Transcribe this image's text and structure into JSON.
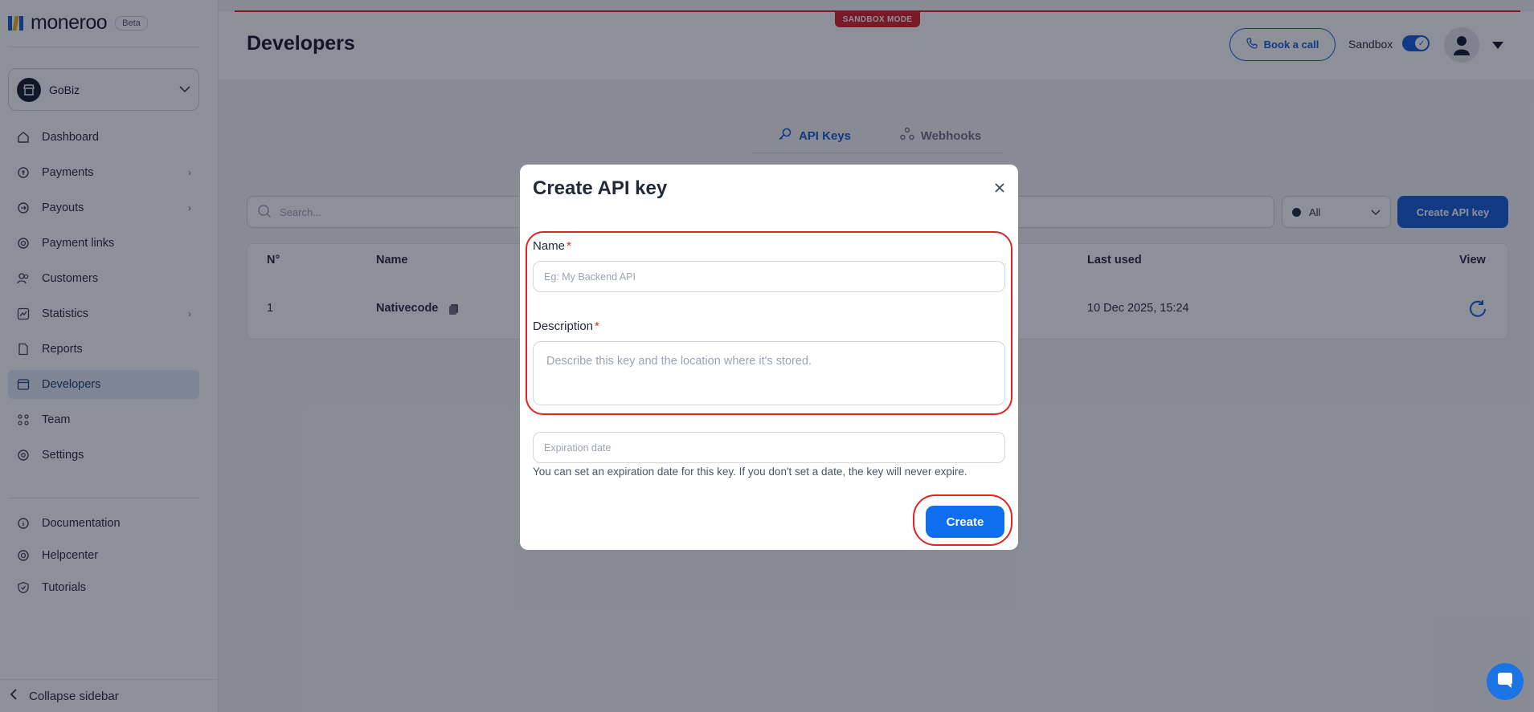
{
  "brand": {
    "name": "moneroo",
    "badge": "Beta"
  },
  "org": {
    "name": "GoBiz"
  },
  "nav": [
    {
      "label": "Dashboard"
    },
    {
      "label": "Payments",
      "arrow": "›"
    },
    {
      "label": "Payouts",
      "arrow": "›"
    },
    {
      "label": "Payment links"
    },
    {
      "label": "Customers"
    },
    {
      "label": "Statistics",
      "arrow": "›"
    },
    {
      "label": "Reports"
    },
    {
      "label": "Developers"
    },
    {
      "label": "Team"
    },
    {
      "label": "Settings"
    }
  ],
  "nav_secondary": [
    {
      "label": "Documentation"
    },
    {
      "label": "Helpcenter"
    },
    {
      "label": "Tutorials"
    }
  ],
  "collapse_label": "Collapse sidebar",
  "sandbox_badge": "SANDBOX MODE",
  "header": {
    "title": "Developers",
    "book_call": "Book a call",
    "sandbox_label": "Sandbox"
  },
  "tabs": [
    {
      "label": "API Keys"
    },
    {
      "label": "Webhooks"
    }
  ],
  "search": {
    "placeholder": "Search..."
  },
  "filter": {
    "selected": "All"
  },
  "create_api_key_button": "Create API key",
  "table": {
    "columns": [
      "N°",
      "Name",
      "Last used",
      "View"
    ],
    "rows": [
      {
        "number": "1",
        "name": "Nativecode",
        "last_used": "10 Dec 2025, 15:24"
      }
    ]
  },
  "modal": {
    "title": "Create API key",
    "name_label": "Name",
    "name_placeholder": "Eg: My Backend API",
    "description_label": "Description",
    "description_placeholder": "Describe this key and the location where it's stored.",
    "required_mark": "*",
    "expiration_placeholder": "Expiration date",
    "expiration_hint": "You can set an expiration date for this key. If you don't set a date, the key will never expire.",
    "create_button": "Create"
  },
  "colors": {
    "primary": "#1458d6",
    "danger": "#e02424",
    "active_nav_bg": "#e3ecfb"
  }
}
